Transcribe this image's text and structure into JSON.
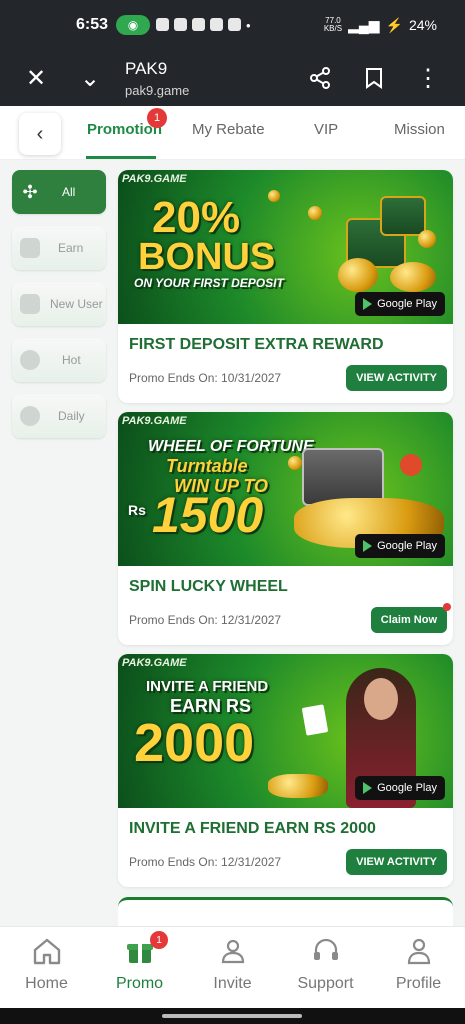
{
  "status": {
    "time": "6:53",
    "net_speed": "77.0",
    "net_unit": "KB/S",
    "battery": "24%"
  },
  "browser": {
    "title": "PAK9",
    "url": "pak9.game"
  },
  "tabs": [
    {
      "label": "Promotion",
      "badge": "1"
    },
    {
      "label": "My Rebate"
    },
    {
      "label": "VIP"
    },
    {
      "label": "Mission"
    }
  ],
  "sidebar": [
    {
      "label": "All"
    },
    {
      "label": "Earn"
    },
    {
      "label": "New User"
    },
    {
      "label": "Hot"
    },
    {
      "label": "Daily"
    }
  ],
  "promos": [
    {
      "brand": "PAK9.GAME",
      "banner_line1": "20%",
      "banner_line2": "BONUS",
      "banner_line3": "ON YOUR FIRST DEPOSIT",
      "store": "Google Play",
      "title": "FIRST DEPOSIT EXTRA REWARD",
      "ends": "Promo Ends On: 10/31/2027",
      "button": "VIEW ACTIVITY"
    },
    {
      "brand": "PAK9.GAME",
      "banner_line1": "WHEEL OF FORTUNE",
      "banner_line2": "Turntable",
      "banner_line3": "WIN UP TO",
      "banner_line4": "Rs",
      "banner_line5": "1500",
      "store": "Google Play",
      "title": "SPIN LUCKY WHEEL",
      "ends": "Promo Ends On: 12/31/2027",
      "button": "Claim Now"
    },
    {
      "brand": "PAK9.GAME",
      "banner_line1": "INVITE A FRIEND",
      "banner_line2": "EARN RS",
      "banner_line3": "2000",
      "store": "Google Play",
      "title": "INVITE A FRIEND EARN RS 2000",
      "ends": "Promo Ends On: 12/31/2027",
      "button": "VIEW ACTIVITY"
    }
  ],
  "bottom_nav": [
    {
      "label": "Home",
      "icon": "home-icon"
    },
    {
      "label": "Promo",
      "icon": "gift-icon",
      "badge": "1"
    },
    {
      "label": "Invite",
      "icon": "people-icon"
    },
    {
      "label": "Support",
      "icon": "headset-icon"
    },
    {
      "label": "Profile",
      "icon": "person-icon"
    }
  ]
}
